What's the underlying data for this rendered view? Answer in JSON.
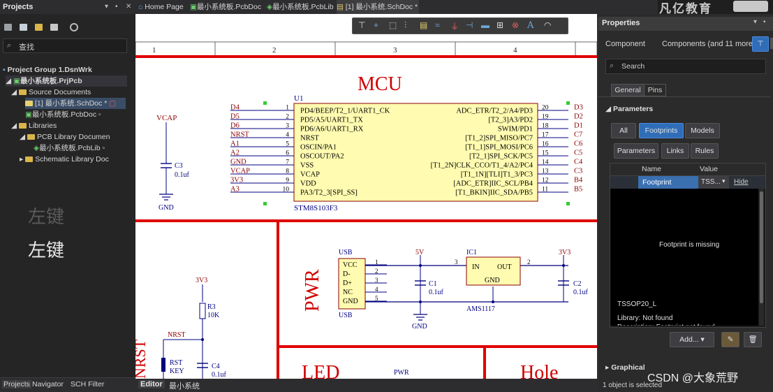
{
  "left_panel": {
    "title": "Projects",
    "search_placeholder": "查找",
    "tree": {
      "group": "Project Group 1.DsnWrk",
      "project": "最小系统板.PrjPcb",
      "source_docs": "Source Documents",
      "sch_doc": "[1] 最小系统.SchDoc *",
      "pcb_doc": "最小系统板.PcbDoc",
      "libraries": "Libraries",
      "pcb_lib_docs": "PCB Library Documen",
      "pcb_lib": "最小系统板.PcbLib",
      "sch_lib_docs": "Schematic Library Doc"
    },
    "ghost_text": "左键",
    "label_text": "左键",
    "bottom_tabs": [
      "Projects",
      "Navigator",
      "SCH Filter"
    ]
  },
  "doc_tabs": [
    "Home Page",
    "最小系统板.PcbDoc",
    "最小系统板.PcbLib",
    "[1] 最小系统.SchDoc *"
  ],
  "editor_tabs": [
    "Editor",
    "最小系统"
  ],
  "brand": "凡亿教育",
  "schematic": {
    "zones": [
      "1",
      "2",
      "3",
      "4"
    ],
    "mcu_title": "MCU",
    "pwr_title": "PWR",
    "led_title": "LED",
    "hole_title": "Hole",
    "u1": {
      "ref": "U1",
      "part": "STM8S103F3",
      "left_nets": [
        "D4",
        "D5",
        "D6",
        "NRST",
        "A1",
        "A2",
        "GND",
        "VCAP",
        "3V3",
        "A3"
      ],
      "left_nums": [
        "1",
        "2",
        "3",
        "4",
        "5",
        "6",
        "7",
        "8",
        "9",
        "10"
      ],
      "left_pins": [
        "PD4/BEEP/T2_1/UART1_CK",
        "PD5/A5/UART1_TX",
        "PD6/A6/UART1_RX",
        "NRST",
        "OSCIN/PA1",
        "OSCOUT/PA2",
        "VSS",
        "VCAP",
        "VDD",
        "PA3/T2_3[SPI_SS]"
      ],
      "right_nums": [
        "20",
        "19",
        "18",
        "17",
        "16",
        "15",
        "14",
        "13",
        "12",
        "11"
      ],
      "right_pins": [
        "ADC_ETR/T2_2/A4/PD3",
        "[T2_3]A3/PD2",
        "SWIM/PD1",
        "[T1_2]SPI_MISO/PC7",
        "[T1_1]SPI_MOSI/PC6",
        "[T2_1]SPI_SCK/PC5",
        "[T1_2N]CLK_CCO/T1_4/A2/PC4",
        "[T1_1N][TLI]T1_3/PC3",
        "[ADC_ETR]IIC_SCL/PB4",
        "[T1_BKIN]IIC_SDA/PB5"
      ],
      "right_nets": [
        "D3",
        "D2",
        "D1",
        "C7",
        "C6",
        "C5",
        "C4",
        "C3",
        "B4",
        "B5"
      ]
    },
    "vcap": {
      "net": "VCAP",
      "ref": "C3",
      "value": "0.1uf",
      "gnd": "GND"
    },
    "usb": {
      "ref": "USB",
      "part": "USB",
      "pins": [
        "VCC",
        "D-",
        "D+",
        "NC",
        "GND"
      ],
      "nums": [
        "1",
        "2",
        "3",
        "4",
        "5"
      ]
    },
    "ic1": {
      "ref": "IC1",
      "part": "AMS1117",
      "in": "IN",
      "out": "OUT",
      "gnd": "GND",
      "pin_in": "3",
      "pin_out": "2",
      "v_in": "5V",
      "v_out": "3V3"
    },
    "c1": {
      "ref": "C1",
      "value": "0.1uf"
    },
    "c2": {
      "ref": "C2",
      "value": "0.1uf"
    },
    "gnd_label": "GND",
    "reset": {
      "v": "3V3",
      "r_ref": "R3",
      "r_val": "10K",
      "net": "NRST",
      "sw": "RST",
      "sw2": "KEY",
      "c_ref": "C4",
      "c_val": "0.1uf",
      "side": "NRST"
    },
    "led_pwr": "PWR"
  },
  "properties": {
    "title": "Properties",
    "component": "Component",
    "components_summary": "Components (and 11 more)",
    "search": "Search",
    "tabs": [
      "General",
      "Pins"
    ],
    "section": "Parameters",
    "filters1": [
      "All",
      "Footprints",
      "Models"
    ],
    "filters2": [
      "Parameters",
      "Links",
      "Rules"
    ],
    "col_name": "Name",
    "col_value": "Value",
    "row_name": "Footprint",
    "row_value": "TSS...",
    "row_hide": "Hide",
    "missing": "Footprint is missing",
    "fp_name": "TSSOP20_L",
    "library": "Library: Not found",
    "description": "Description: Footprint not found",
    "add_btn": "Add...",
    "graphical": "Graphical",
    "status": "1 object is selected",
    "watermark": "CSDN @大象荒野"
  },
  "colors": {
    "accent": "#2f6db8",
    "wire": "#000080",
    "sheet_red": "#e00000"
  }
}
